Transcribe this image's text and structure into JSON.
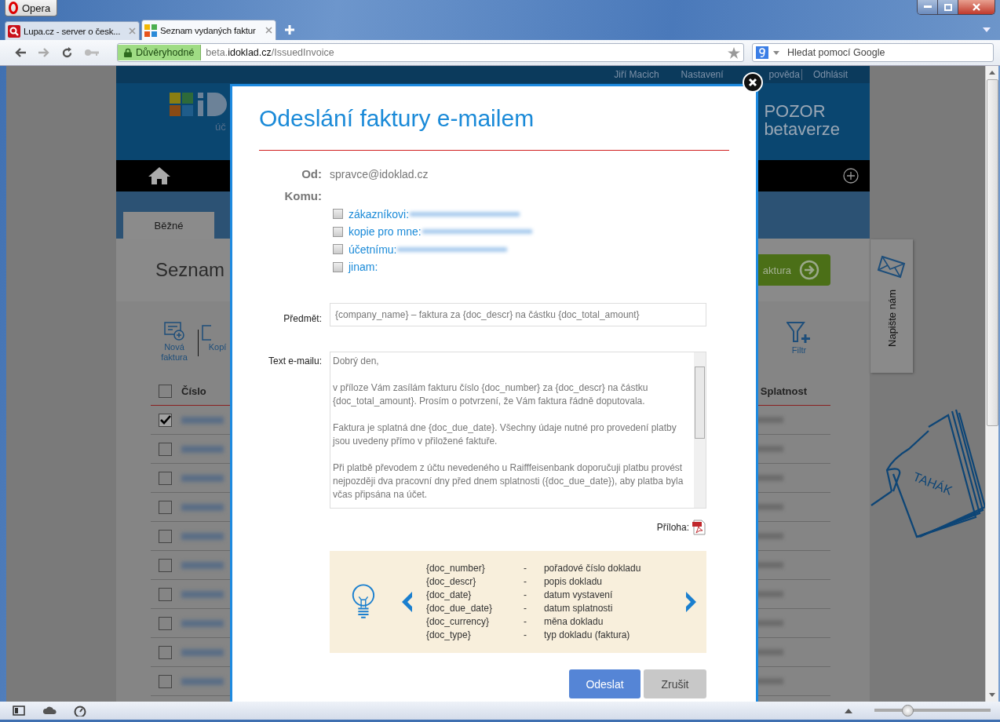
{
  "browser": {
    "menu_button": "Opera",
    "tabs": [
      {
        "title": "Lupa.cz - server o česk...",
        "selected": false
      },
      {
        "title": "Seznam vydaných faktur",
        "selected": true
      }
    ],
    "trust_badge": "Důvěryhodné",
    "url": {
      "prefix": "beta.",
      "domain": "idoklad.cz",
      "path": "/IssuedInvoice"
    },
    "search": {
      "placeholder": "Hledat pomocí Google"
    },
    "zoom": {
      "level": 0.28
    }
  },
  "page": {
    "user": "Jiří Macich",
    "links": [
      "Nastavení",
      "pověda",
      "Odhlásit"
    ],
    "logo_subtitle": "úč",
    "notice": [
      "POZOR",
      "betaverze"
    ],
    "tab": "Běžné",
    "heading": "Seznam",
    "new_button": "aktura",
    "toolbar": [
      {
        "kind": "new",
        "label": "Nová faktura"
      },
      {
        "kind": "copy",
        "label": "Kopí"
      }
    ],
    "filter": "Filtr",
    "columns": [
      "Číslo",
      "Splatnost"
    ],
    "all_checked": false,
    "rows": [
      {
        "checked": true
      },
      {
        "checked": false
      },
      {
        "checked": false
      },
      {
        "checked": false
      },
      {
        "checked": false
      },
      {
        "checked": false
      },
      {
        "checked": false
      },
      {
        "checked": false
      },
      {
        "checked": false
      },
      {
        "checked": false
      }
    ],
    "feedback": "Napište nám",
    "cheat_sheet": "TAHÁK"
  },
  "dialog": {
    "title": "Odeslání faktury e-mailem",
    "from_label": "Od:",
    "from": "spravce@idoklad.cz",
    "to_label": "Komu:",
    "recipients": [
      {
        "label": "zákazníkovi:",
        "checked": false,
        "address_hidden": true
      },
      {
        "label": "kopie pro mne:",
        "checked": false,
        "address_hidden": true
      },
      {
        "label": "účetnímu:",
        "checked": false,
        "address_hidden": true
      },
      {
        "label": "jinam:",
        "checked": false,
        "address_hidden": false
      }
    ],
    "subject_label": "Předmět:",
    "subject": "{company_name} – faktura za {doc_descr} na částku {doc_total_amount}",
    "body_label": "Text e-mailu:",
    "body": [
      "Dobrý den,",
      "v příloze Vám zasílám fakturu číslo {doc_number} za {doc_descr} na částku {doc_total_amount}. Prosím o potvrzení, že Vám faktura řádně doputovala.",
      "Faktura je splatná dne {doc_due_date}. Všechny údaje nutné pro provedení platby jsou uvedeny přímo v přiložené faktuře.",
      "Při platbě převodem z účtu nevedeného u Raifffeisenbank doporučuji platbu provést nejpozději dva pracovní dny před dnem splatnosti ({doc_due_date}), aby platba byla včas připsána na účet."
    ],
    "attachment_label": "Příloha:",
    "hints": [
      {
        "token": "{doc_number}",
        "dash": "-",
        "meaning": "pořadové číslo dokladu"
      },
      {
        "token": "{doc_descr}",
        "dash": "-",
        "meaning": "popis dokladu"
      },
      {
        "token": "{doc_date}",
        "dash": "-",
        "meaning": "datum vystavení"
      },
      {
        "token": "{doc_due_date}",
        "dash": "-",
        "meaning": "datum splatnosti"
      },
      {
        "token": "{doc_currency}",
        "dash": "-",
        "meaning": "měna dokladu"
      },
      {
        "token": "{doc_type}",
        "dash": "-",
        "meaning": "typ dokladu (faktura)"
      }
    ],
    "buttons": [
      {
        "kind": "primary",
        "label": "Odeslat"
      },
      {
        "kind": "secondary",
        "label": "Zrušit"
      }
    ]
  }
}
